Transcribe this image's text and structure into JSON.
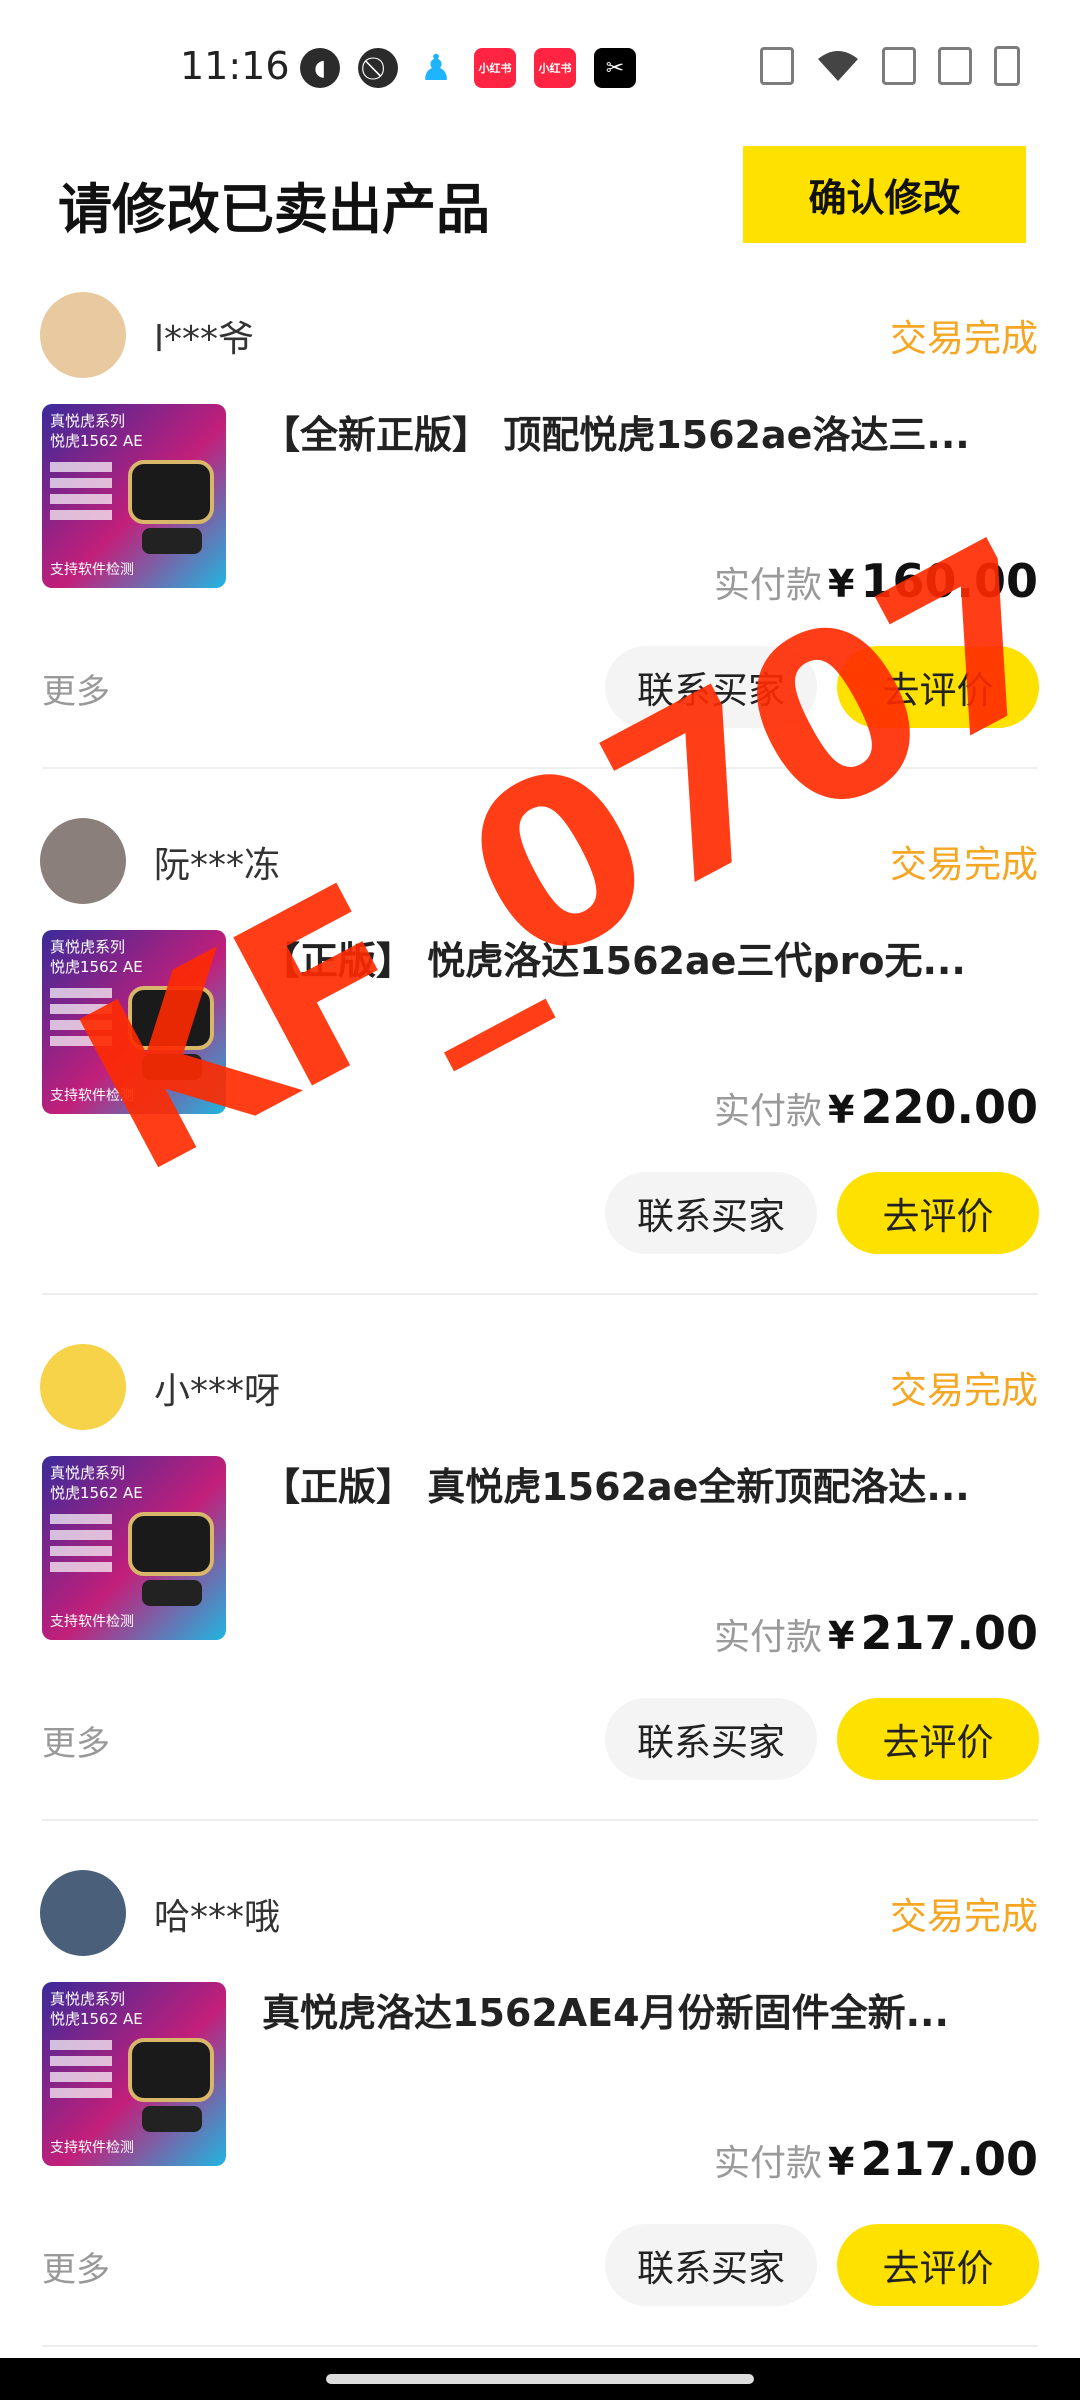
{
  "status_bar": {
    "time": "11:16",
    "left_icons": [
      "pinned-app-icon",
      "circle-slash-icon",
      "qq-icon",
      "xiaohongshu-icon",
      "xiaohongshu-icon",
      "capcut-icon"
    ],
    "right_icons": [
      "vibrate-icon",
      "wifi-icon",
      "no-sim-icon",
      "no-sim-icon",
      "battery-charging-icon"
    ],
    "red_app_label": "小红书"
  },
  "header": {
    "title": "请修改已卖出产品",
    "confirm_label": "确认修改"
  },
  "orders": [
    {
      "buyer": "l***爷",
      "status": "交易完成",
      "title": "【全新正版】 顶配悦虎1562ae洛达三...",
      "price_label": "实付款",
      "currency": "¥",
      "price": "160.00",
      "more": "更多",
      "contact": "联系买家",
      "review": "去评价"
    },
    {
      "buyer": "阮***冻",
      "status": "交易完成",
      "title": "【正版】 悦虎洛达1562ae三代pro无...",
      "price_label": "实付款",
      "currency": "¥",
      "price": "220.00",
      "more": "",
      "contact": "联系买家",
      "review": "去评价"
    },
    {
      "buyer": "小***呀",
      "status": "交易完成",
      "title": "【正版】 真悦虎1562ae全新顶配洛达...",
      "price_label": "实付款",
      "currency": "¥",
      "price": "217.00",
      "more": "更多",
      "contact": "联系买家",
      "review": "去评价"
    },
    {
      "buyer": "哈***哦",
      "status": "交易完成",
      "title": "真悦虎洛达1562AE4月份新固件全新...",
      "price_label": "实付款",
      "currency": "¥",
      "price": "217.00",
      "more": "更多",
      "contact": "联系买家",
      "review": "去评价"
    }
  ],
  "thumbnail": {
    "line1": "真悦虎系列",
    "line2": "悦虎1562 AE",
    "footer": "支持软件检测"
  },
  "watermark": "KF_0707",
  "colors": {
    "accent_yellow": "#ffe100",
    "status_orange": "#f5a623",
    "watermark_red": "#ff2a00"
  }
}
